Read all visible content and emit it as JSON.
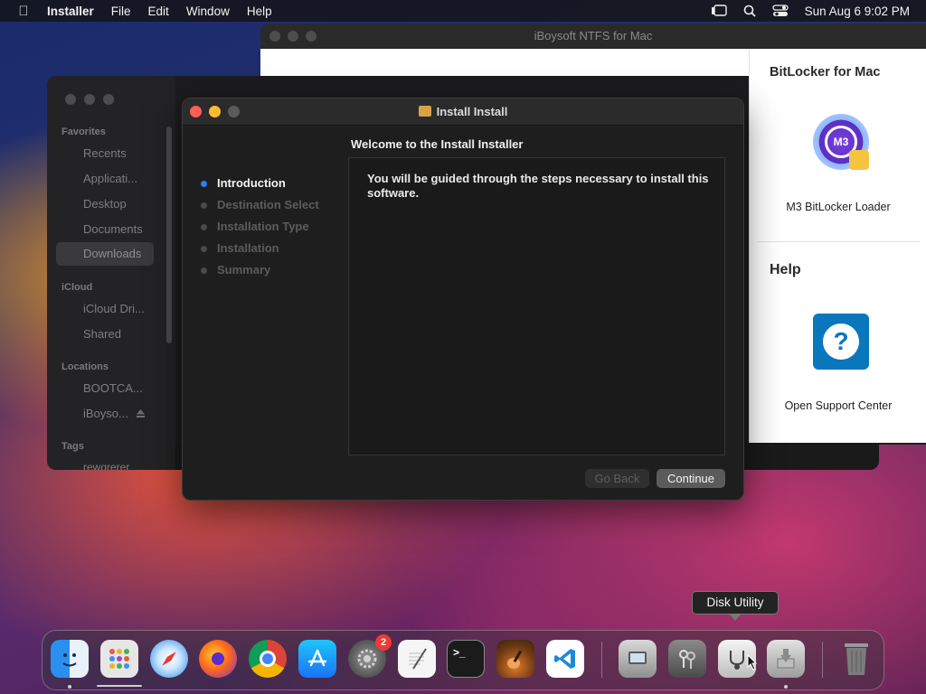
{
  "menubar": {
    "app": "Installer",
    "items": [
      "File",
      "Edit",
      "Window",
      "Help"
    ],
    "clock": "Sun Aug 6  9:02 PM"
  },
  "ntfs": {
    "title": "iBoysoft NTFS for Mac",
    "section1_title": "BitLocker for Mac",
    "icon1_text": "M3",
    "item1": "M3 BitLocker Loader",
    "section2_title": "Help",
    "icon2_text": "?",
    "item2": "Open Support Center"
  },
  "finder": {
    "favorites_head": "Favorites",
    "favorites": [
      "Recents",
      "Applicati...",
      "Desktop",
      "Documents",
      "Downloads"
    ],
    "icloud_head": "iCloud",
    "icloud": [
      "iCloud Dri...",
      "Shared"
    ],
    "locations_head": "Locations",
    "locations": [
      "BOOTCA...",
      "iBoyso..."
    ],
    "tags_head": "Tags",
    "tags": [
      "rewqrerer"
    ]
  },
  "installer": {
    "title": "Install Install",
    "heading": "Welcome to the Install Installer",
    "steps": [
      "Introduction",
      "Destination Select",
      "Installation Type",
      "Installation",
      "Summary"
    ],
    "active_step": "Introduction",
    "body": "You will be guided through the steps necessary to install this software.",
    "back_label": "Go Back",
    "continue_label": "Continue"
  },
  "dock": {
    "tooltip": "Disk Utility",
    "settings_badge": "2",
    "terminal_prompt": ">_"
  },
  "colors": {
    "accent": "#2f7cf6",
    "close": "#fe5f57",
    "minimize": "#febc2e"
  }
}
